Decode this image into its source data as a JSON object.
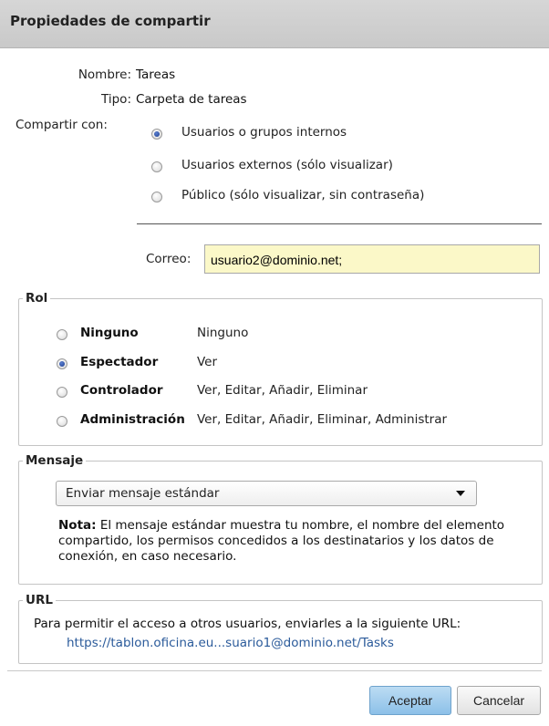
{
  "dialog": {
    "title": "Propiedades de compartir"
  },
  "info": {
    "name_label": "Nombre:",
    "name_value": "Tareas",
    "type_label": "Tipo:",
    "type_value": "Carpeta de tareas",
    "share_with_label": "Compartir con:"
  },
  "share_options": [
    {
      "label": "Usuarios o grupos internos",
      "selected": true
    },
    {
      "label": "Usuarios externos (sólo visualizar)",
      "selected": false
    },
    {
      "label": "Público (sólo visualizar, sin contraseña)",
      "selected": false
    }
  ],
  "email": {
    "label": "Correo:",
    "value": "usuario2@dominio.net;"
  },
  "role": {
    "legend": "Rol",
    "options": [
      {
        "name": "Ninguno",
        "desc": "Ninguno",
        "selected": false
      },
      {
        "name": "Espectador",
        "desc": "Ver",
        "selected": true
      },
      {
        "name": "Controlador",
        "desc": "Ver, Editar, Añadir, Eliminar",
        "selected": false
      },
      {
        "name": "Administración",
        "desc": "Ver, Editar, Añadir, Eliminar, Administrar",
        "selected": false
      }
    ]
  },
  "message": {
    "legend": "Mensaje",
    "selected_option": "Enviar mensaje estándar",
    "note_bold": "Nota:",
    "note_text": " El mensaje estándar muestra tu nombre, el nombre del elemento compartido, los permisos concedidos a los destinatarios y los datos de conexión, en caso necesario."
  },
  "url": {
    "legend": "URL",
    "description": "Para permitir el acceso a otros usuarios, enviarles a la siguiente URL:",
    "link": "https://tablon.oficina.eu...suario1@dominio.net/Tasks"
  },
  "buttons": {
    "accept": "Aceptar",
    "cancel": "Cancelar"
  },
  "colors": {
    "title_bar": "#cfcfcf",
    "email_field_bg": "#fbf8c8",
    "link": "#2a5a9a",
    "primary_button": "#a3cdef"
  }
}
